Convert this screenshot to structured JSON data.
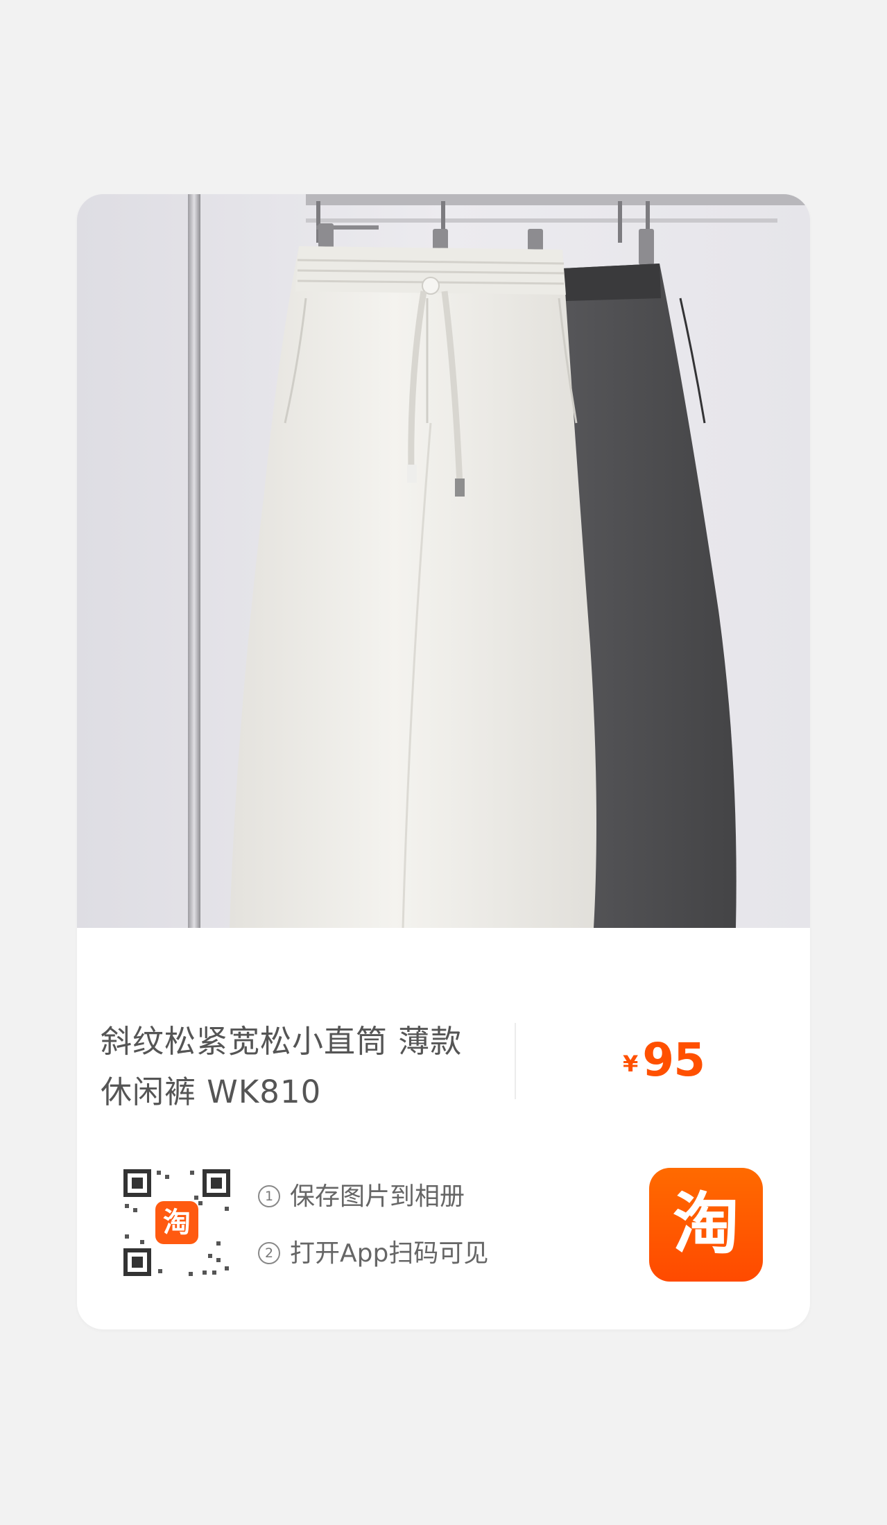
{
  "product": {
    "title_line1": "斜纹松紧宽松小直筒 薄款",
    "title_line2": "休闲裤 WK810",
    "price_currency": "¥",
    "price_amount": "95",
    "image_alt": "pants-photo"
  },
  "share": {
    "step1_num": "1",
    "step1_text": "保存图片到相册",
    "step2_num": "2",
    "step2_text": "打开App扫码可见"
  },
  "app_logo": {
    "glyph": "淘",
    "color": "#ff5000"
  },
  "qr_logo": {
    "glyph": "淘"
  },
  "colors": {
    "accent": "#ff5000",
    "background": "#f2f2f2",
    "card": "#ffffff",
    "text": "#555555"
  }
}
